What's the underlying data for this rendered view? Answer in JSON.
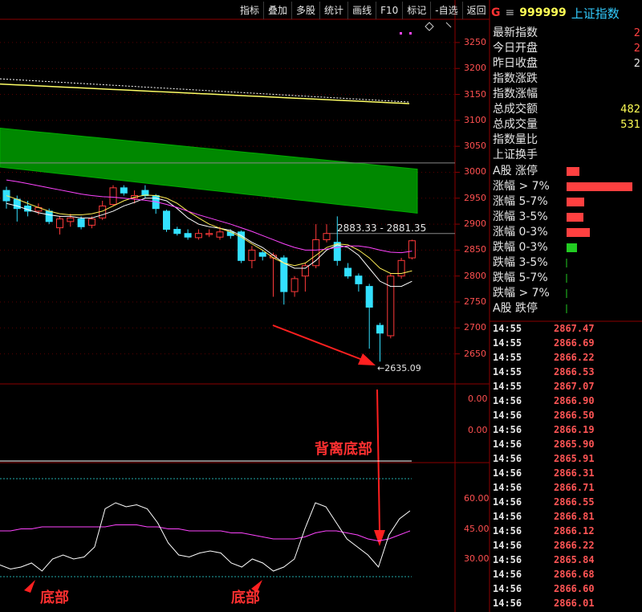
{
  "toolbar": [
    "指标",
    "叠加",
    "多股",
    "统计",
    "画线",
    "F10",
    "标记",
    "-自选",
    "返回"
  ],
  "header": {
    "market": "G",
    "menu_glyph": "≡",
    "code": "999999",
    "name": "上证指数"
  },
  "info_rows": [
    {
      "label": "最新指数",
      "value": "2",
      "color": "#ff4040"
    },
    {
      "label": "今日开盘",
      "value": "2",
      "color": "#ff4040"
    },
    {
      "label": "昨日收盘",
      "value": "2",
      "color": "#e6e6e6"
    },
    {
      "label": "指数涨跌",
      "value": "",
      "color": "#e6e6e6"
    },
    {
      "label": "指数涨幅",
      "value": "",
      "color": "#e6e6e6"
    },
    {
      "label": "总成交额",
      "value": "482",
      "color": "#ffff55"
    },
    {
      "label": "总成交量",
      "value": "531",
      "color": "#ffff55"
    },
    {
      "label": "指数量比",
      "value": "",
      "color": "#e6e6e6"
    },
    {
      "label": "上证换手",
      "value": "",
      "color": "#e6e6e6"
    }
  ],
  "breadth": [
    {
      "label": "A股 涨停",
      "level": 0.2,
      "color": "#ff4040"
    },
    {
      "label": "涨幅 > 7%",
      "level": 1.0,
      "color": "#ff4040"
    },
    {
      "label": "涨幅 5-7%",
      "level": 0.27,
      "color": "#ff4040"
    },
    {
      "label": "涨幅 3-5%",
      "level": 0.25,
      "color": "#ff4040"
    },
    {
      "label": "涨幅 0-3%",
      "level": 0.35,
      "color": "#ff4040"
    },
    {
      "label": "跌幅 0-3%",
      "level": 0.16,
      "color": "#22cc22"
    },
    {
      "label": "跌幅 3-5%",
      "level": 0.0,
      "color": "#22cc22"
    },
    {
      "label": "跌幅 5-7%",
      "level": 0.0,
      "color": "#22cc22"
    },
    {
      "label": "跌幅 > 7%",
      "level": 0.0,
      "color": "#22cc22"
    },
    {
      "label": "A股 跌停",
      "level": 0.0,
      "color": "#22cc22"
    }
  ],
  "ticks": [
    [
      "14:55",
      "2867.47"
    ],
    [
      "14:55",
      "2866.69"
    ],
    [
      "14:55",
      "2866.22"
    ],
    [
      "14:55",
      "2866.53"
    ],
    [
      "14:55",
      "2867.07"
    ],
    [
      "14:56",
      "2866.90"
    ],
    [
      "14:56",
      "2866.50"
    ],
    [
      "14:56",
      "2866.19"
    ],
    [
      "14:56",
      "2865.90"
    ],
    [
      "14:56",
      "2865.91"
    ],
    [
      "14:56",
      "2866.31"
    ],
    [
      "14:56",
      "2866.71"
    ],
    [
      "14:56",
      "2866.55"
    ],
    [
      "14:56",
      "2866.81"
    ],
    [
      "14:56",
      "2866.12"
    ],
    [
      "14:56",
      "2866.22"
    ],
    [
      "14:56",
      "2865.84"
    ],
    [
      "14:56",
      "2866.68"
    ],
    [
      "14:56",
      "2866.60"
    ],
    [
      "14:56",
      "2866.01"
    ]
  ],
  "price_axis": [
    "3250",
    "3200",
    "3150",
    "3100",
    "3050",
    "3000",
    "2950",
    "2900",
    "2850",
    "2800",
    "2750",
    "2700",
    "2650"
  ],
  "sub_axis": [
    "0.00",
    "0.00"
  ],
  "ind_axis": [
    "60.00",
    "45.00",
    "30.00"
  ],
  "price_range_label": "2883.33 - 2881.35",
  "low_label": "2635.09",
  "annotations": {
    "divergence": "背离底部",
    "bottom1": "底部",
    "bottom2": "底部"
  },
  "chart_data": {
    "type": "candlestick",
    "ylim": [
      2620,
      3270
    ],
    "candles": [
      {
        "o": 2965,
        "c": 2945,
        "h": 2972,
        "l": 2930
      },
      {
        "o": 2948,
        "c": 2930,
        "h": 2955,
        "l": 2905
      },
      {
        "o": 2935,
        "c": 2925,
        "h": 2945,
        "l": 2915
      },
      {
        "o": 2925,
        "c": 2932,
        "h": 2940,
        "l": 2918
      },
      {
        "o": 2925,
        "c": 2905,
        "h": 2930,
        "l": 2900
      },
      {
        "o": 2893,
        "c": 2910,
        "h": 2915,
        "l": 2880
      },
      {
        "o": 2905,
        "c": 2912,
        "h": 2920,
        "l": 2895
      },
      {
        "o": 2910,
        "c": 2895,
        "h": 2915,
        "l": 2890
      },
      {
        "o": 2898,
        "c": 2910,
        "h": 2915,
        "l": 2892
      },
      {
        "o": 2912,
        "c": 2935,
        "h": 2945,
        "l": 2908
      },
      {
        "o": 2938,
        "c": 2970,
        "h": 2975,
        "l": 2935
      },
      {
        "o": 2970,
        "c": 2960,
        "h": 2975,
        "l": 2955
      },
      {
        "o": 2950,
        "c": 2955,
        "h": 2965,
        "l": 2940
      },
      {
        "o": 2965,
        "c": 2955,
        "h": 2975,
        "l": 2950
      },
      {
        "o": 2955,
        "c": 2930,
        "h": 2958,
        "l": 2920
      },
      {
        "o": 2925,
        "c": 2890,
        "h": 2928,
        "l": 2885
      },
      {
        "o": 2890,
        "c": 2882,
        "h": 2895,
        "l": 2878
      },
      {
        "o": 2882,
        "c": 2875,
        "h": 2890,
        "l": 2870
      },
      {
        "o": 2874,
        "c": 2882,
        "h": 2890,
        "l": 2870
      },
      {
        "o": 2880,
        "c": 2882,
        "h": 2890,
        "l": 2875
      },
      {
        "o": 2875,
        "c": 2885,
        "h": 2895,
        "l": 2870
      },
      {
        "o": 2885,
        "c": 2878,
        "h": 2890,
        "l": 2872
      },
      {
        "o": 2885,
        "c": 2830,
        "h": 2888,
        "l": 2825
      },
      {
        "o": 2830,
        "c": 2850,
        "h": 2858,
        "l": 2815
      },
      {
        "o": 2845,
        "c": 2838,
        "h": 2850,
        "l": 2830
      },
      {
        "o": 2835,
        "c": 2840,
        "h": 2845,
        "l": 2760
      },
      {
        "o": 2835,
        "c": 2770,
        "h": 2840,
        "l": 2745
      },
      {
        "o": 2770,
        "c": 2795,
        "h": 2800,
        "l": 2760
      },
      {
        "o": 2800,
        "c": 2820,
        "h": 2825,
        "l": 2770
      },
      {
        "o": 2820,
        "c": 2870,
        "h": 2900,
        "l": 2815
      },
      {
        "o": 2870,
        "c": 2882,
        "h": 2900,
        "l": 2865
      },
      {
        "o": 2865,
        "c": 2830,
        "h": 2915,
        "l": 2820
      },
      {
        "o": 2815,
        "c": 2800,
        "h": 2825,
        "l": 2795
      },
      {
        "o": 2800,
        "c": 2785,
        "h": 2805,
        "l": 2770
      },
      {
        "o": 2780,
        "c": 2740,
        "h": 2785,
        "l": 2660
      },
      {
        "o": 2705,
        "c": 2690,
        "h": 2710,
        "l": 2635
      },
      {
        "o": 2685,
        "c": 2800,
        "h": 2805,
        "l": 2680
      },
      {
        "o": 2800,
        "c": 2830,
        "h": 2835,
        "l": 2795
      },
      {
        "o": 2835,
        "c": 2868,
        "h": 2870,
        "l": 2832
      }
    ],
    "ma_white": [
      2940,
      2935,
      2928,
      2922,
      2918,
      2915,
      2915,
      2912,
      2912,
      2918,
      2925,
      2935,
      2942,
      2950,
      2950,
      2945,
      2930,
      2912,
      2900,
      2895,
      2892,
      2888,
      2878,
      2865,
      2855,
      2840,
      2825,
      2815,
      2815,
      2830,
      2850,
      2860,
      2855,
      2840,
      2815,
      2790,
      2780,
      2780,
      2790
    ],
    "ma_yellow": [
      2955,
      2948,
      2940,
      2932,
      2925,
      2920,
      2918,
      2918,
      2920,
      2925,
      2935,
      2945,
      2952,
      2956,
      2955,
      2950,
      2940,
      2925,
      2912,
      2900,
      2892,
      2885,
      2875,
      2862,
      2850,
      2835,
      2825,
      2820,
      2825,
      2840,
      2855,
      2862,
      2860,
      2850,
      2835,
      2815,
      2805,
      2805,
      2810
    ],
    "ma_magenta": [
      2985,
      2982,
      2978,
      2974,
      2970,
      2966,
      2962,
      2958,
      2955,
      2953,
      2952,
      2950,
      2948,
      2946,
      2943,
      2938,
      2932,
      2925,
      2918,
      2912,
      2906,
      2900,
      2893,
      2886,
      2878,
      2870,
      2862,
      2855,
      2850,
      2850,
      2852,
      2855,
      2858,
      2858,
      2855,
      2850,
      2846,
      2845,
      2848
    ],
    "rsi": [
      27,
      25,
      26,
      28,
      24,
      30,
      32,
      30,
      31,
      36,
      55,
      58,
      56,
      57,
      55,
      48,
      38,
      32,
      31,
      33,
      34,
      33,
      28,
      26,
      30,
      28,
      24,
      26,
      30,
      45,
      58,
      56,
      48,
      40,
      36,
      32,
      26,
      42,
      50,
      54
    ],
    "rsi_ma": [
      44,
      44,
      45,
      45,
      46,
      46,
      46,
      46,
      46,
      46,
      46,
      47,
      47,
      47,
      46,
      46,
      45,
      45,
      44,
      44,
      44,
      44,
      43,
      43,
      42,
      41,
      40,
      40,
      40,
      41,
      43,
      44,
      44,
      43,
      42,
      40,
      39,
      40,
      42,
      44
    ]
  }
}
